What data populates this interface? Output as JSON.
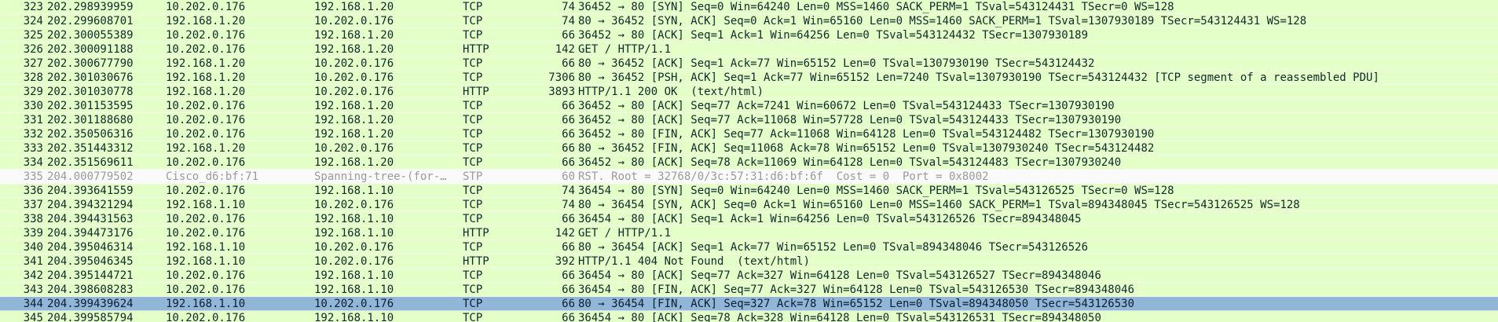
{
  "colors": {
    "http_row": "#e4ffc7",
    "stp_row": "#fafafa",
    "selected_row": "#92b6d7"
  },
  "packets": [
    {
      "no": "323",
      "time": "202.298939959",
      "source": "10.202.0.176",
      "destination": "192.168.1.20",
      "protocol": "TCP",
      "length": "74",
      "info": "36452 → 80 [SYN] Seq=0 Win=64240 Len=0 MSS=1460 SACK_PERM=1 TSval=543124431 TSecr=0 WS=128",
      "row_style": "green"
    },
    {
      "no": "324",
      "time": "202.299608701",
      "source": "192.168.1.20",
      "destination": "10.202.0.176",
      "protocol": "TCP",
      "length": "74",
      "info": "80 → 36452 [SYN, ACK] Seq=0 Ack=1 Win=65160 Len=0 MSS=1460 SACK_PERM=1 TSval=1307930189 TSecr=543124431 WS=128",
      "row_style": "green"
    },
    {
      "no": "325",
      "time": "202.300055389",
      "source": "10.202.0.176",
      "destination": "192.168.1.20",
      "protocol": "TCP",
      "length": "66",
      "info": "36452 → 80 [ACK] Seq=1 Ack=1 Win=64256 Len=0 TSval=543124432 TSecr=1307930189",
      "row_style": "green"
    },
    {
      "no": "326",
      "time": "202.300091188",
      "source": "10.202.0.176",
      "destination": "192.168.1.20",
      "protocol": "HTTP",
      "length": "142",
      "info": "GET / HTTP/1.1",
      "row_style": "green"
    },
    {
      "no": "327",
      "time": "202.300677790",
      "source": "192.168.1.20",
      "destination": "10.202.0.176",
      "protocol": "TCP",
      "length": "66",
      "info": "80 → 36452 [ACK] Seq=1 Ack=77 Win=65152 Len=0 TSval=1307930190 TSecr=543124432",
      "row_style": "green"
    },
    {
      "no": "328",
      "time": "202.301030676",
      "source": "192.168.1.20",
      "destination": "10.202.0.176",
      "protocol": "TCP",
      "length": "7306",
      "info": "80 → 36452 [PSH, ACK] Seq=1 Ack=77 Win=65152 Len=7240 TSval=1307930190 TSecr=543124432 [TCP segment of a reassembled PDU]",
      "row_style": "green"
    },
    {
      "no": "329",
      "time": "202.301030778",
      "source": "192.168.1.20",
      "destination": "10.202.0.176",
      "protocol": "HTTP",
      "length": "3893",
      "info": "HTTP/1.1 200 OK  (text/html)",
      "row_style": "green"
    },
    {
      "no": "330",
      "time": "202.301153595",
      "source": "10.202.0.176",
      "destination": "192.168.1.20",
      "protocol": "TCP",
      "length": "66",
      "info": "36452 → 80 [ACK] Seq=77 Ack=7241 Win=60672 Len=0 TSval=543124433 TSecr=1307930190",
      "row_style": "green"
    },
    {
      "no": "331",
      "time": "202.301188680",
      "source": "10.202.0.176",
      "destination": "192.168.1.20",
      "protocol": "TCP",
      "length": "66",
      "info": "36452 → 80 [ACK] Seq=77 Ack=11068 Win=57728 Len=0 TSval=543124433 TSecr=1307930190",
      "row_style": "green"
    },
    {
      "no": "332",
      "time": "202.350506316",
      "source": "10.202.0.176",
      "destination": "192.168.1.20",
      "protocol": "TCP",
      "length": "66",
      "info": "36452 → 80 [FIN, ACK] Seq=77 Ack=11068 Win=64128 Len=0 TSval=543124482 TSecr=1307930190",
      "row_style": "green"
    },
    {
      "no": "333",
      "time": "202.351443312",
      "source": "192.168.1.20",
      "destination": "10.202.0.176",
      "protocol": "TCP",
      "length": "66",
      "info": "80 → 36452 [FIN, ACK] Seq=11068 Ack=78 Win=65152 Len=0 TSval=1307930240 TSecr=543124482",
      "row_style": "green"
    },
    {
      "no": "334",
      "time": "202.351569611",
      "source": "10.202.0.176",
      "destination": "192.168.1.20",
      "protocol": "TCP",
      "length": "66",
      "info": "36452 → 80 [ACK] Seq=78 Ack=11069 Win=64128 Len=0 TSval=543124483 TSecr=1307930240",
      "row_style": "green"
    },
    {
      "no": "335",
      "time": "204.000779502",
      "source": "Cisco_d6:bf:71",
      "destination": "Spanning-tree-(for-…",
      "protocol": "STP",
      "length": "60",
      "info": "RST. Root = 32768/0/3c:57:31:d6:bf:6f  Cost = 0  Port = 0x8002",
      "row_style": "stp"
    },
    {
      "no": "336",
      "time": "204.393641559",
      "source": "10.202.0.176",
      "destination": "192.168.1.10",
      "protocol": "TCP",
      "length": "74",
      "info": "36454 → 80 [SYN] Seq=0 Win=64240 Len=0 MSS=1460 SACK_PERM=1 TSval=543126525 TSecr=0 WS=128",
      "row_style": "green"
    },
    {
      "no": "337",
      "time": "204.394321294",
      "source": "192.168.1.10",
      "destination": "10.202.0.176",
      "protocol": "TCP",
      "length": "74",
      "info": "80 → 36454 [SYN, ACK] Seq=0 Ack=1 Win=65160 Len=0 MSS=1460 SACK_PERM=1 TSval=894348045 TSecr=543126525 WS=128",
      "row_style": "green"
    },
    {
      "no": "338",
      "time": "204.394431563",
      "source": "10.202.0.176",
      "destination": "192.168.1.10",
      "protocol": "TCP",
      "length": "66",
      "info": "36454 → 80 [ACK] Seq=1 Ack=1 Win=64256 Len=0 TSval=543126526 TSecr=894348045",
      "row_style": "green"
    },
    {
      "no": "339",
      "time": "204.394473176",
      "source": "10.202.0.176",
      "destination": "192.168.1.10",
      "protocol": "HTTP",
      "length": "142",
      "info": "GET / HTTP/1.1",
      "row_style": "green"
    },
    {
      "no": "340",
      "time": "204.395046314",
      "source": "192.168.1.10",
      "destination": "10.202.0.176",
      "protocol": "TCP",
      "length": "66",
      "info": "80 → 36454 [ACK] Seq=1 Ack=77 Win=65152 Len=0 TSval=894348046 TSecr=543126526",
      "row_style": "green"
    },
    {
      "no": "341",
      "time": "204.395046345",
      "source": "192.168.1.10",
      "destination": "10.202.0.176",
      "protocol": "HTTP",
      "length": "392",
      "info": "HTTP/1.1 404 Not Found  (text/html)",
      "row_style": "green"
    },
    {
      "no": "342",
      "time": "204.395144721",
      "source": "10.202.0.176",
      "destination": "192.168.1.10",
      "protocol": "TCP",
      "length": "66",
      "info": "36454 → 80 [ACK] Seq=77 Ack=327 Win=64128 Len=0 TSval=543126527 TSecr=894348046",
      "row_style": "green"
    },
    {
      "no": "343",
      "time": "204.398608283",
      "source": "10.202.0.176",
      "destination": "192.168.1.10",
      "protocol": "TCP",
      "length": "66",
      "info": "36454 → 80 [FIN, ACK] Seq=77 Ack=327 Win=64128 Len=0 TSval=543126530 TSecr=894348046",
      "row_style": "green"
    },
    {
      "no": "344",
      "time": "204.399439624",
      "source": "192.168.1.10",
      "destination": "10.202.0.176",
      "protocol": "TCP",
      "length": "66",
      "info": "80 → 36454 [FIN, ACK] Seq=327 Ack=78 Win=65152 Len=0 TSval=894348050 TSecr=543126530",
      "row_style": "selected"
    },
    {
      "no": "345",
      "time": "204.399585794",
      "source": "10.202.0.176",
      "destination": "192.168.1.10",
      "protocol": "TCP",
      "length": "66",
      "info": "36454 → 80 [ACK] Seq=78 Ack=328 Win=64128 Len=0 TSval=543126531 TSecr=894348050",
      "row_style": "green"
    }
  ]
}
